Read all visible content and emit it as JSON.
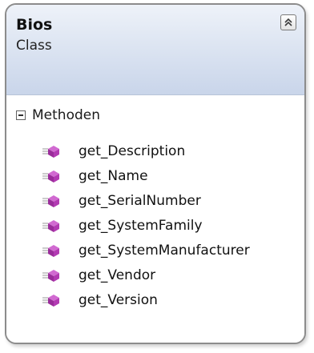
{
  "class_shape": {
    "name": "Bios",
    "kind": "Class",
    "collapse_icon": "double-chevron-up-icon"
  },
  "section": {
    "label": "Methoden",
    "toggle_icon": "collapse-minus-icon"
  },
  "methods": [
    {
      "label": "get_Description",
      "icon": "method-icon"
    },
    {
      "label": "get_Name",
      "icon": "method-icon"
    },
    {
      "label": "get_SerialNumber",
      "icon": "method-icon"
    },
    {
      "label": "get_SystemFamily",
      "icon": "method-icon"
    },
    {
      "label": "get_SystemManufacturer",
      "icon": "method-icon"
    },
    {
      "label": "get_Vendor",
      "icon": "method-icon"
    },
    {
      "label": "get_Version",
      "icon": "method-icon"
    }
  ],
  "colors": {
    "header_gradient_top": "#eef2f9",
    "header_gradient_bottom": "#c9d5ea",
    "method_icon": "#b23ab2",
    "border": "#8c8c8c"
  }
}
